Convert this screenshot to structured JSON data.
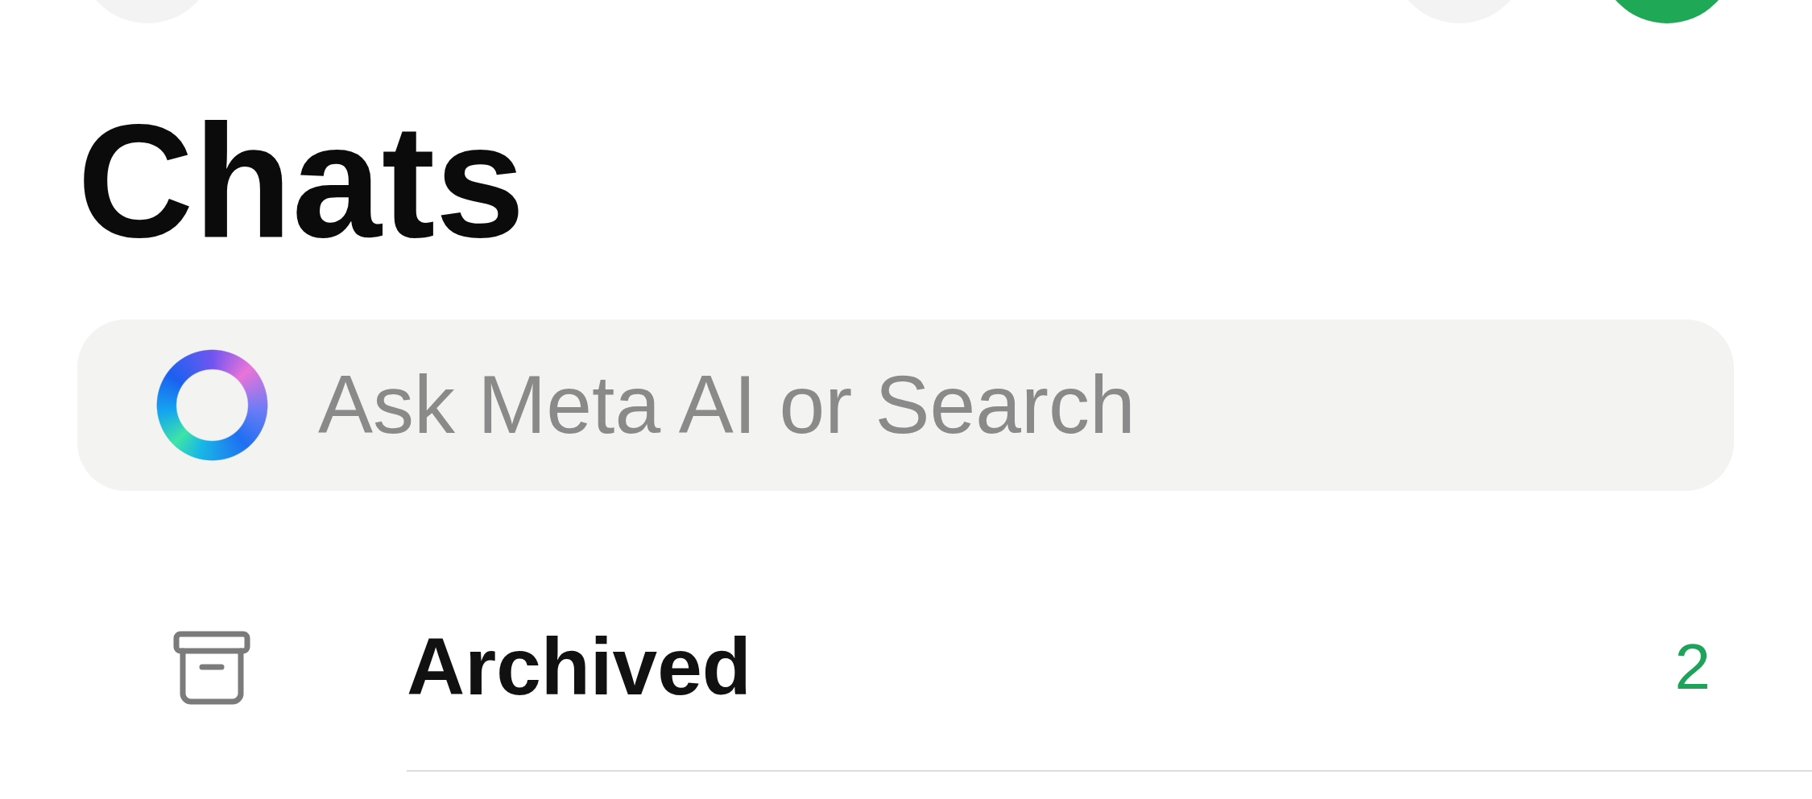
{
  "top_bar": {
    "left_buttons": [
      {
        "kind": "secondary"
      }
    ],
    "right_buttons": [
      {
        "kind": "secondary"
      },
      {
        "kind": "primary"
      }
    ]
  },
  "title": "Chats",
  "search": {
    "placeholder": "Ask Meta AI or Search"
  },
  "archived_row": {
    "label": "Archived",
    "count": "2"
  }
}
